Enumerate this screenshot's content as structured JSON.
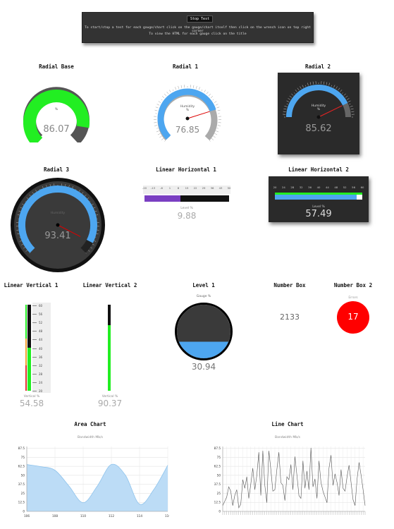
{
  "banner": {
    "stop_label": "Stop Test",
    "line1": "To start/stop a test for each gauge/chart click on the gauge/chart itself then click on the wrench icon on top right corner",
    "line2": "To view the HTML for each gauge click on the title"
  },
  "radial_base": {
    "title": "Radial Base",
    "unit": "%",
    "value": "86.07",
    "fraction": 0.8607
  },
  "radial1": {
    "title": "Radial 1",
    "label": "Humidity",
    "unit": "%",
    "value": "76.85",
    "fraction": 0.7685
  },
  "radial2": {
    "title": "Radial 2",
    "label": "Humidity",
    "unit": "%",
    "value": "85.62",
    "fraction": 0.8562
  },
  "radial3": {
    "title": "Radial 3",
    "label": "Humidity",
    "unit": "%",
    "value": "93.41",
    "fraction": 0.9341
  },
  "linear_h1": {
    "title": "Linear Horizontal 1",
    "label": "Level %",
    "value": "9.88",
    "ticks": [
      "-20",
      "-13",
      "-6",
      "1",
      "8",
      "15",
      "22",
      "29",
      "36",
      "43",
      "50"
    ]
  },
  "linear_h2": {
    "title": "Linear Horizontal 2",
    "label": "Level %",
    "value": "57.49",
    "ticks": [
      "20",
      "24",
      "28",
      "32",
      "36",
      "40",
      "44",
      "48",
      "52",
      "56",
      "60"
    ]
  },
  "linear_v1": {
    "title": "Linear Vertical 1",
    "label": "Vertical %",
    "value": "54.58",
    "ticks": [
      "60",
      "56",
      "52",
      "48",
      "44",
      "40",
      "36",
      "32",
      "28",
      "24",
      "20"
    ]
  },
  "linear_v2": {
    "title": "Linear Vertical 2",
    "label": "Vertical %",
    "value": "90.37"
  },
  "level1": {
    "title": "Level 1",
    "label": "Gauge %",
    "value": "30.94",
    "fraction": 0.3094
  },
  "number_box": {
    "title": "Number Box",
    "value": "2133"
  },
  "number_box2": {
    "title": "Number Box 2",
    "label": "Errors",
    "value": "17"
  },
  "colors": {
    "green": "#22ee22",
    "blue": "#4da6f0",
    "red": "#ff0000",
    "purple": "#7a3fc2"
  },
  "chart_data": [
    {
      "type": "area",
      "title": "Area Chart",
      "subtitle": "Bandwidth Mb/s",
      "x": [
        106,
        107,
        108,
        109,
        110,
        111,
        112,
        113,
        114,
        115,
        116
      ],
      "y": [
        65,
        62,
        57,
        35,
        12,
        35,
        65,
        50,
        10,
        30,
        64
      ],
      "xticks": [
        "106",
        "108",
        "110",
        "112",
        "114",
        "116"
      ],
      "yticks": [
        "0",
        "12.5",
        "25",
        "37.5",
        "50",
        "62.5",
        "75",
        "87.5"
      ],
      "ylim": [
        0,
        90
      ],
      "grid": true
    },
    {
      "type": "line",
      "title": "Line Chart",
      "subtitle": "Bandwidth Mb/s",
      "y": [
        8,
        14,
        20,
        34,
        28,
        8,
        22,
        30,
        5,
        10,
        44,
        32,
        48,
        18,
        38,
        60,
        30,
        50,
        82,
        22,
        84,
        36,
        12,
        84,
        58,
        28,
        30,
        58,
        82,
        40,
        36,
        15,
        48,
        44,
        65,
        30,
        76,
        50,
        22,
        18,
        70,
        32,
        56,
        30,
        88,
        34,
        45,
        18,
        70,
        40,
        28,
        20,
        12,
        60,
        78,
        36,
        52,
        40,
        22,
        58,
        32,
        28,
        48,
        64,
        40,
        16,
        8,
        45,
        68,
        50,
        30,
        8
      ],
      "yticks": [
        "0",
        "12.5",
        "25",
        "37.5",
        "50",
        "62.5",
        "75",
        "87.5"
      ],
      "ylim": [
        0,
        90
      ],
      "grid": true
    }
  ]
}
